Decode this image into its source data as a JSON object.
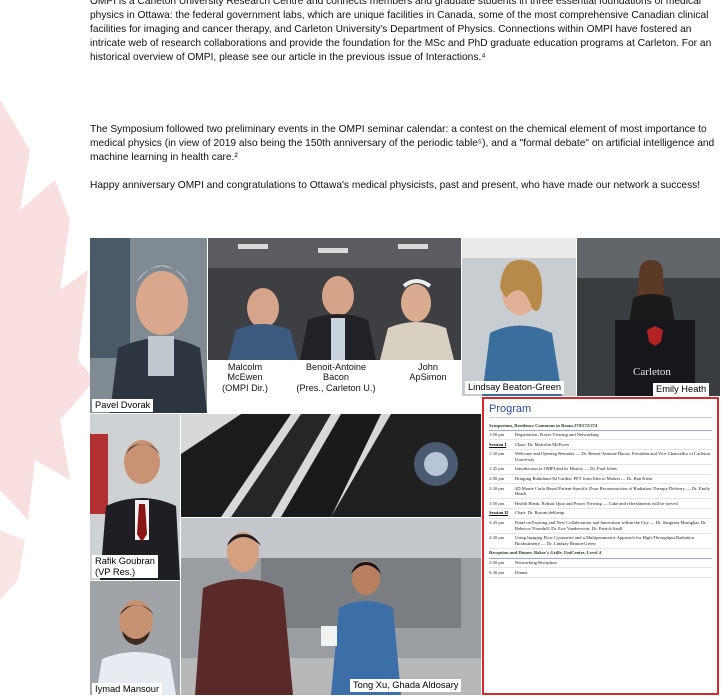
{
  "article": {
    "paragraphs": [
      "OMPI is a Carleton University Research Centre and connects members and graduate students in three essential foundations of medical physics in Ottawa:  the federal government labs, which are unique facilities in Canada, some of the most comprehensive Canadian clinical facilities for imaging and cancer therapy, and Carleton University's Department of Physics.  Connections within OMPI have fostered an intricate web of research collaborations and provide the foundation for the MSc and PhD graduate education programs at Carleton.  For an historical overview of OMPI, please see our article in the previous issue of Interactions.⁴",
      "The Symposium followed two preliminary events in the OMPI seminar calendar:  a contest on the chemical element of most importance to medical physics (in view of 2019 also being the 150th anniversary of the periodic table⁵), and a \"formal debate\" on artificial intelligence and machine learning in health care.²",
      "Happy anniversary OMPI and congratulations to Ottawa's medical physicists, past and present, who have made our network a success!"
    ]
  },
  "captions": {
    "pavel": "Pavel Dvorak",
    "malcolm": "Malcolm\nMcEwen\n(OMPI Dir.)",
    "benoit": "Benoit-Antoine\nBacon\n(Pres., Carleton U.)",
    "john": "John\nApSimon",
    "lindsay": "Lindsay Beaton-Green",
    "emily": "Emily Heath",
    "rafik": "Rafik Goubran\n(VP Res.)",
    "iymad": "Iymad Mansour",
    "tong": "Tong Xu, Ghada Aldosary"
  },
  "podium_text": "Carleton",
  "program": {
    "title": "Program",
    "rows": [
      {
        "kind": "sec",
        "time": "Symposium, Residence Commons in Room 270/272/274",
        "event": ""
      },
      {
        "kind": "row",
        "time": "1:00 pm",
        "event": "Registration, Poster Viewing and Networking"
      },
      {
        "kind": "sess",
        "time": "Session I",
        "event": "Chair: Dr. Malcolm McEwen"
      },
      {
        "kind": "row",
        "time": "1:30 pm",
        "event": "Welcome and Opening Remarks — Dr. Benoit-Antoine Bacon, President and Vice-Chancellor of Carleton University"
      },
      {
        "kind": "row",
        "time": "1:45 pm",
        "event": "Introduction to OMPI and its History — Dr. Paul Johns"
      },
      {
        "kind": "row",
        "time": "2:00 pm",
        "event": "Bringing Rubidium-82 Cardiac PET from Idea to Market — Dr. Ran Klein"
      },
      {
        "kind": "row",
        "time": "2:30 pm",
        "event": "4D Monte Carlo Based Patient-Specific Dose Reconstruction of Radiation Therapy Delivery — Dr. Emily Heath"
      },
      {
        "kind": "row",
        "time": "3:00 pm",
        "event": "Health Break, Robust Quiz and Poster Viewing — Cake and refreshments will be served."
      },
      {
        "kind": "sess",
        "time": "Session II",
        "event": "Chair: Dr. Rowan deKemp"
      },
      {
        "kind": "row",
        "time": "3:45 pm",
        "event": "Panel on Existing and New Collaboration and Innovation within the City — Dr. Sangeeta Murugkar, Dr. Rebecca Thornhill, Dr. Eric Vandervoort, Dr. Patrick Saull"
      },
      {
        "kind": "row",
        "time": "4:30 pm",
        "event": "Using Imaging Flow Cytometry and a Multiparametric Approach for High-Throughput Radiation Biodosimetry — Dr. Lindsay Beaton-Green"
      },
      {
        "kind": "sec",
        "time": "Reception and Dinner, Baker's Grille, UniCentre, Level 4",
        "event": ""
      },
      {
        "kind": "row",
        "time": "5:00 pm",
        "event": "Networking Reception"
      },
      {
        "kind": "row",
        "time": "6:30 pm",
        "event": "Dinner"
      }
    ]
  },
  "colors": {
    "accent_red": "#d62a2a",
    "program_blue": "#2b4f9a",
    "watermark_red": "#f4c4c4"
  }
}
